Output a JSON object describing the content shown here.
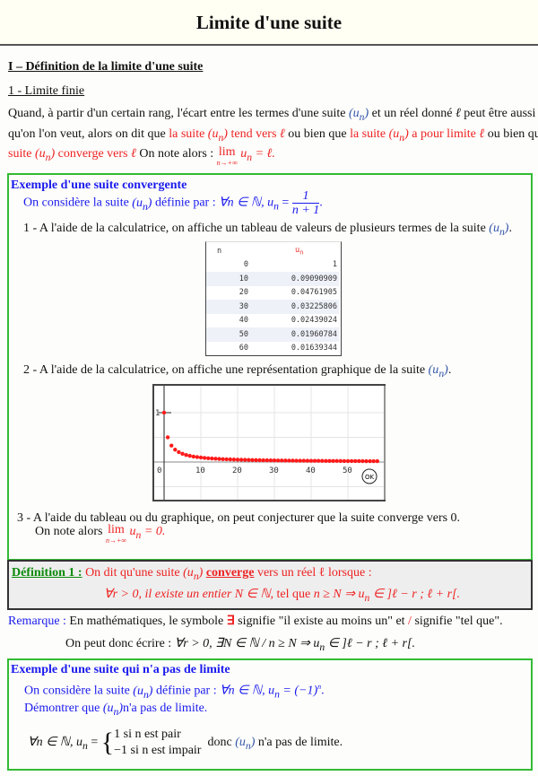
{
  "header": {
    "title": "Limite d'une suite"
  },
  "section": {
    "title": "I – Définition de la limite d'une suite",
    "subtitle": "1 - Limite finie"
  },
  "intro": {
    "l1a": "Quand, à partir d'un certain rang, l'écart entre les termes d'une suite",
    "un": "(u",
    "l1b": "et un réel donné",
    "ell": "ℓ",
    "l1c": "peut être aussi petit",
    "l2a": "qu'on l'on veut, alors on dit que",
    "red1": "la suite",
    "red2": "tend vers",
    "l2b": "ou bien que",
    "red3": "la suite",
    "red4": "a pour limite",
    "l2c": "ou bien que",
    "red5": "la",
    "red6": "suite",
    "red7": "converge vers",
    "l3": "On note alors :",
    "lim": "lim",
    "lim_sub": "n→+∞",
    "lim_rhs": "u",
    "lim_eq": "= ℓ."
  },
  "example1": {
    "title": "Exemple d'une suite convergente",
    "def_text": "On considère la suite",
    "def_by": "définie par :",
    "def_formula": "∀n ∈ ℕ, u",
    "def_eq": "=",
    "frac_num": "1",
    "frac_den": "n + 1",
    "step1": "1 - A l'aide de la calculatrice, on affiche un tableau de valeurs de plusieurs termes de la suite",
    "table": {
      "headers": [
        "n",
        "u"
      ],
      "rows": [
        [
          "0",
          "1"
        ],
        [
          "10",
          "0.09090909"
        ],
        [
          "20",
          "0.04761905"
        ],
        [
          "30",
          "0.03225806"
        ],
        [
          "40",
          "0.02439024"
        ],
        [
          "50",
          "0.01960784"
        ],
        [
          "60",
          "0.01639344"
        ]
      ]
    },
    "step2": "2 - A l'aide de la calculatrice, on affiche une représentation graphique de la suite",
    "step3": "3 - A l'aide du tableau ou du graphique, on peut conjecturer que la suite converge vers 0.",
    "step3b": "On note alors",
    "step3_eq": "= 0."
  },
  "chart_data": {
    "type": "scatter",
    "formula": "u_n = 1/(n+1)",
    "x_ticks": [
      "0",
      "10",
      "20",
      "30",
      "40",
      "50"
    ],
    "y_ticks": [
      "1"
    ],
    "xlim": [
      -2,
      60
    ],
    "n_range": [
      0,
      58
    ],
    "ok_button": "OK",
    "point_color": "#ff1a1a",
    "grid": true
  },
  "definition": {
    "label": "Définition 1 :",
    "text_a": "On dit qu'une suite",
    "converge": "converge",
    "text_b": "vers un réel ℓ lorsque :",
    "formula_a": "∀r > 0,  il existe un entier",
    "formula_b": "N ∈ ℕ,",
    "formula_c": "tel que",
    "formula_d": "n ≥ N  ⇒  u",
    "formula_e": "∈ ]ℓ − r ; ℓ + r[."
  },
  "remark": {
    "label": "Remarque :",
    "text_a": "En mathématiques, le symbole",
    "exists": "∃",
    "text_b": "signifie \"il existe au moins un\" et",
    "slash": "/",
    "text_c": "signifie \"tel que\".",
    "line2": "On peut donc écrire :",
    "line2_formula": "∀r > 0, ∃N ∈ ℕ / n ≥ N ⇒ u",
    "line2_end": "∈ ]ℓ − r ; ℓ + r[."
  },
  "example2": {
    "title": "Exemple d'une suite qui n'a pas de limite",
    "def_text": "On considère la suite",
    "def_by": "définie par :",
    "def_formula": "∀n ∈ ℕ, u",
    "def_rhs": "= (−1)",
    "show": "Démontrer que",
    "show_b": "n'a pas de limite.",
    "sol_a": "∀n ∈ ℕ, u",
    "case1": "1 si n est pair",
    "case2": "−1 si n est impair",
    "sol_b": "donc",
    "sol_c": "n'a pas de limite."
  },
  "colors": {
    "red": "#ee2222",
    "blue": "#1a1aee",
    "green_border": "#33bb33",
    "def_green": "#0a8a0a",
    "header_bg": "#fffff3"
  }
}
